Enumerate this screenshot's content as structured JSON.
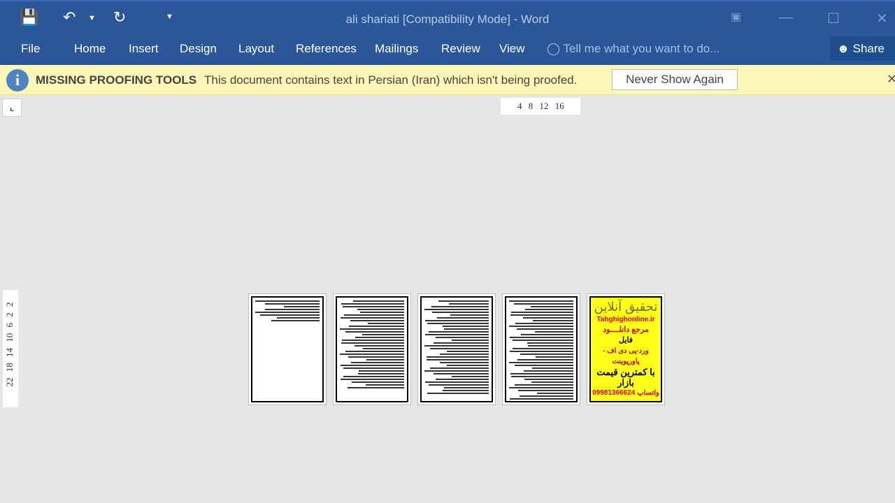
{
  "quick_access": {
    "save_icon": "save-icon",
    "undo_icon": "undo-icon",
    "redo_icon": "redo-icon",
    "customize_icon": "customize-icon"
  },
  "window": {
    "title": "ali shariati [Compatibility Mode] - Word"
  },
  "ribbon": {
    "tabs": [
      "File",
      "Home",
      "Insert",
      "Design",
      "Layout",
      "References",
      "Mailings",
      "Review",
      "View"
    ],
    "tell_me": "Tell me what you want to do...",
    "share": "Share"
  },
  "message_bar": {
    "title": "MISSING PROOFING TOOLS",
    "message": "This document contains text in Persian (Iran) which isn't being proofed.",
    "button": "Never Show Again"
  },
  "rulers": {
    "horizontal": "4 8 12 16",
    "vertical": "22 18 14 10 6 2 2"
  },
  "ad_page": {
    "lines": [
      "تحقیق آنلاین",
      "Tahghighonline.ir",
      "مرجع دانلــــود",
      "فایل",
      "ورد-پی دی اف - پاورپوینت",
      "با کمترین قیمت بازار",
      "09981366624 واتساپ"
    ]
  },
  "colors": {
    "ribbon": "#2b579a",
    "message_bar": "#fcf7b6",
    "ad_bg": "#ffff1a"
  }
}
